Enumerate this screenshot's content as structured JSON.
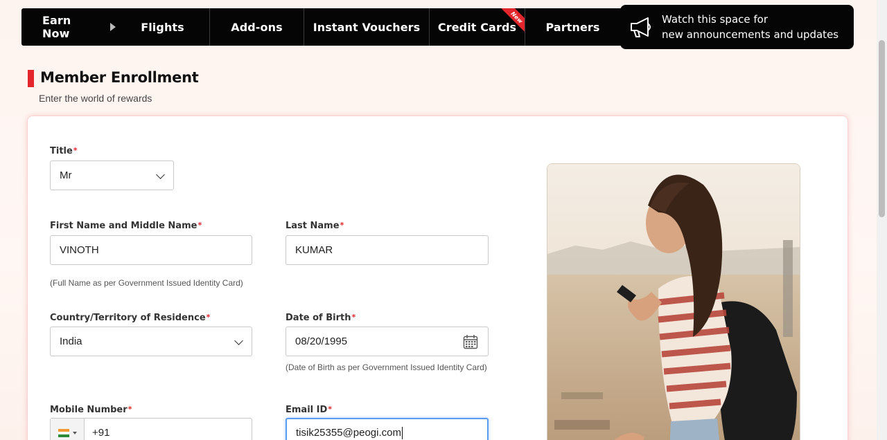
{
  "nav": {
    "items": [
      {
        "label": "Earn Now"
      },
      {
        "label": "Flights"
      },
      {
        "label": "Add-ons"
      },
      {
        "label": "Instant Vouchers"
      },
      {
        "label": "Credit Cards",
        "badge": "New"
      },
      {
        "label": "Partners"
      }
    ],
    "announcement_line1": "Watch this space for",
    "announcement_line2": "new announcements and updates"
  },
  "page": {
    "title": "Member Enrollment",
    "subtitle": "Enter the world of rewards"
  },
  "form": {
    "title": {
      "label": "Title",
      "required": "*",
      "value": "Mr"
    },
    "first_name": {
      "label": "First Name and Middle Name",
      "required": "*",
      "value": "VINOTH",
      "hint": "(Full Name as per Government Issued Identity Card)"
    },
    "last_name": {
      "label": "Last Name",
      "required": "*",
      "value": "KUMAR"
    },
    "country": {
      "label": "Country/Territory of Residence",
      "required": "*",
      "value": "India"
    },
    "dob": {
      "label": "Date of Birth",
      "required": "*",
      "value": "08/20/1995",
      "hint": "(Date of Birth as per Government Issued Identity Card)"
    },
    "mobile": {
      "label": "Mobile Number",
      "required": "*",
      "code": "+91"
    },
    "email": {
      "label": "Email ID",
      "required": "*",
      "value": "tisik25355@peogi.com"
    }
  },
  "colors": {
    "accent": "#e3262b",
    "nav_bg": "#050505",
    "focus": "#5b9cf0"
  }
}
